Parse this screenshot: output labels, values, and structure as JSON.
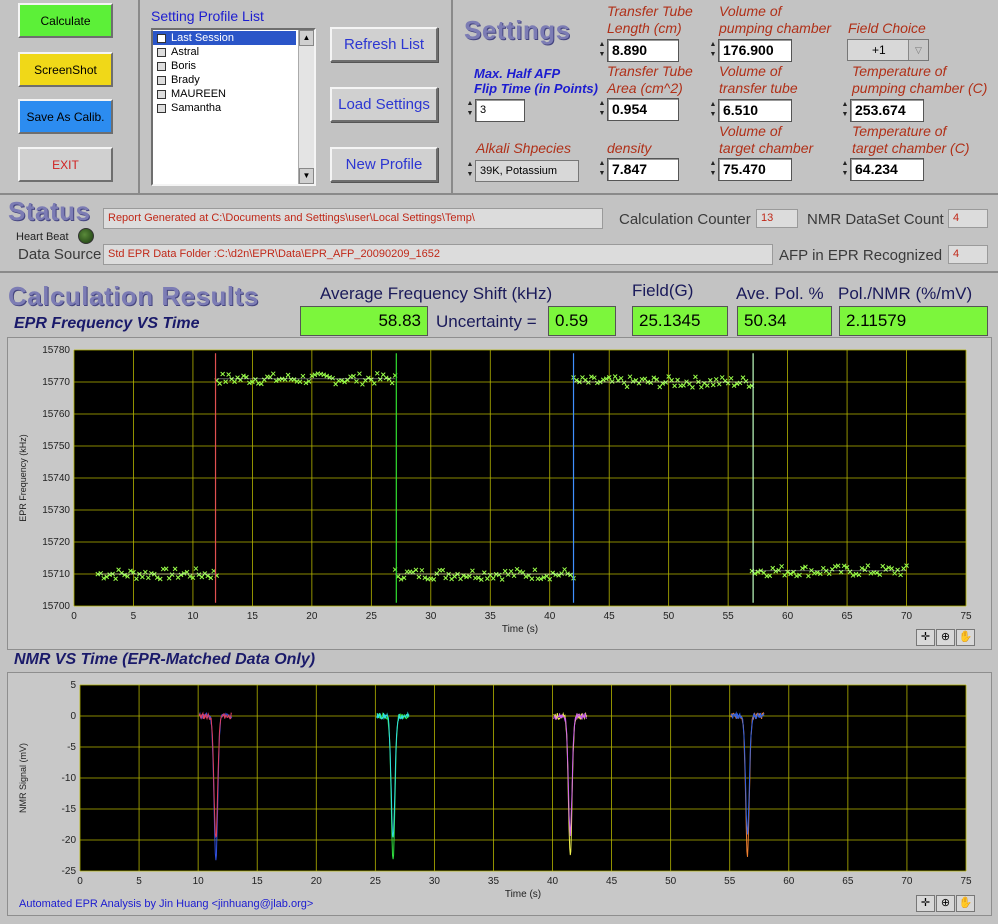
{
  "buttons": {
    "calculate": "Calculate",
    "screenshot": "ScreenShot",
    "save_calib": "Save As Calib.",
    "exit": "EXIT",
    "refresh_list": "Refresh List",
    "load_settings": "Load Settings",
    "new_profile": "New Profile"
  },
  "profile_list": {
    "title": "Setting Profile List",
    "items": [
      "Last Session",
      "Astral",
      "Boris",
      "Brady",
      "MAUREEN",
      "Samantha"
    ]
  },
  "settings": {
    "title": "Settings",
    "afp_label_line1": "Max. Half AFP",
    "afp_label_line2": "Flip Time (in Points)",
    "afp_value": "3",
    "alkali_label": "Alkali Shpecies",
    "alkali_value": "39K, Potassium",
    "tt_length_label1": "Transfer Tube",
    "tt_length_label2": "Length (cm)",
    "tt_length_value": "8.890",
    "tt_area_label1": "Transfer Tube",
    "tt_area_label2": "Area (cm^2)",
    "tt_area_value": "0.954",
    "density_label": "density",
    "density_value": "7.847",
    "vol_pump_label1": "Volume of",
    "vol_pump_label2": "pumping chamber",
    "vol_pump_value": "176.900",
    "vol_tt_label1": "Volume of",
    "vol_tt_label2": "transfer tube",
    "vol_tt_value": "6.510",
    "vol_target_label1": "Volume of",
    "vol_target_label2": "target chamber",
    "vol_target_value": "75.470",
    "field_choice_label": "Field Choice",
    "field_choice_value": "+1",
    "temp_pump_label1": "Temperature of",
    "temp_pump_label2": "pumping chamber (C)",
    "temp_pump_value": "253.674",
    "temp_target_label1": "Temperature of",
    "temp_target_label2": "target chamber (C)",
    "temp_target_value": "64.234"
  },
  "status": {
    "title": "Status",
    "report": "Report Generated at C:\\Documents and Settings\\user\\Local Settings\\Temp\\",
    "heartbeat_label": "Heart Beat",
    "data_source_label": "Data Source",
    "data_source": "Std EPR Data Folder :C:\\d2n\\EPR\\Data\\EPR_AFP_20090209_1652",
    "calc_counter_label": "Calculation Counter",
    "calc_counter": "13",
    "nmr_count_label": "NMR DataSet Count",
    "nmr_count": "4",
    "afp_recognized_label": "AFP in EPR Recognized",
    "afp_recognized": "4"
  },
  "results": {
    "title": "Calculation Results",
    "avg_freq_label": "Average Frequency Shift (kHz)",
    "avg_freq": "58.83",
    "uncertainty_label": "Uncertainty =",
    "uncertainty": "0.59",
    "field_label": "Field(G)",
    "field": "25.1345",
    "ave_pol_label": "Ave. Pol. %",
    "ave_pol": "50.34",
    "pol_nmr_label": "Pol./NMR (%/mV)",
    "pol_nmr": "2.11579"
  },
  "epr_chart_title": "EPR Frequency VS Time",
  "nmr_chart_title": "NMR VS Time (EPR-Matched Data Only)",
  "footer": "Automated EPR Analysis by Jin Huang <jinhuang@jlab.org>",
  "colors": {
    "green": "#7cf63c",
    "title_blue": "#7c7cb4",
    "plot_bg": "#000000",
    "grid": "#b4b400"
  },
  "chart_data": [
    {
      "type": "scatter",
      "title": "EPR Frequency VS Time",
      "xlabel": "Time (s)",
      "ylabel": "EPR Frequency (kHz)",
      "xlim": [
        0,
        75
      ],
      "ylim": [
        15700,
        15780
      ],
      "xticks": [
        0,
        5,
        10,
        15,
        20,
        25,
        30,
        35,
        40,
        45,
        50,
        55,
        60,
        65,
        70,
        75
      ],
      "yticks": [
        15700,
        15710,
        15720,
        15730,
        15740,
        15750,
        15760,
        15770,
        15780
      ],
      "grid": true,
      "segments": [
        {
          "x_start": 2,
          "x_end": 12,
          "level": 15710
        },
        {
          "x_start": 12,
          "x_end": 27,
          "level": 15771
        },
        {
          "x_start": 27,
          "x_end": 42,
          "level": 15710
        },
        {
          "x_start": 42,
          "x_end": 57,
          "level": 15770
        },
        {
          "x_start": 57,
          "x_end": 70,
          "level": 15711
        }
      ],
      "flip_lines": [
        {
          "x": 11.9,
          "color": "#e05050"
        },
        {
          "x": 27.1,
          "color": "#30e030"
        },
        {
          "x": 42.0,
          "color": "#4090ff"
        },
        {
          "x": 57.1,
          "color": "#c0ffc0"
        }
      ]
    },
    {
      "type": "line",
      "title": "NMR VS Time (EPR-Matched Data Only)",
      "xlabel": "Time (s)",
      "ylabel": "NMR Signal (mV)",
      "xlim": [
        0,
        75
      ],
      "ylim": [
        -25,
        5
      ],
      "xticks": [
        0,
        5,
        10,
        15,
        20,
        25,
        30,
        35,
        40,
        45,
        50,
        55,
        60,
        65,
        70,
        75
      ],
      "yticks": [
        -25,
        -20,
        -15,
        -10,
        -5,
        0,
        5
      ],
      "grid": true,
      "dips": [
        {
          "center": 11.5,
          "depth": -23.5,
          "colors": [
            "#3050e0",
            "#e04060"
          ]
        },
        {
          "center": 26.5,
          "depth": -23.5,
          "colors": [
            "#30e040",
            "#30e0e0"
          ]
        },
        {
          "center": 41.5,
          "depth": -22.5,
          "colors": [
            "#f0f050",
            "#d060f0"
          ]
        },
        {
          "center": 56.5,
          "depth": -22.5,
          "colors": [
            "#f08030",
            "#3060e0"
          ]
        }
      ]
    }
  ]
}
